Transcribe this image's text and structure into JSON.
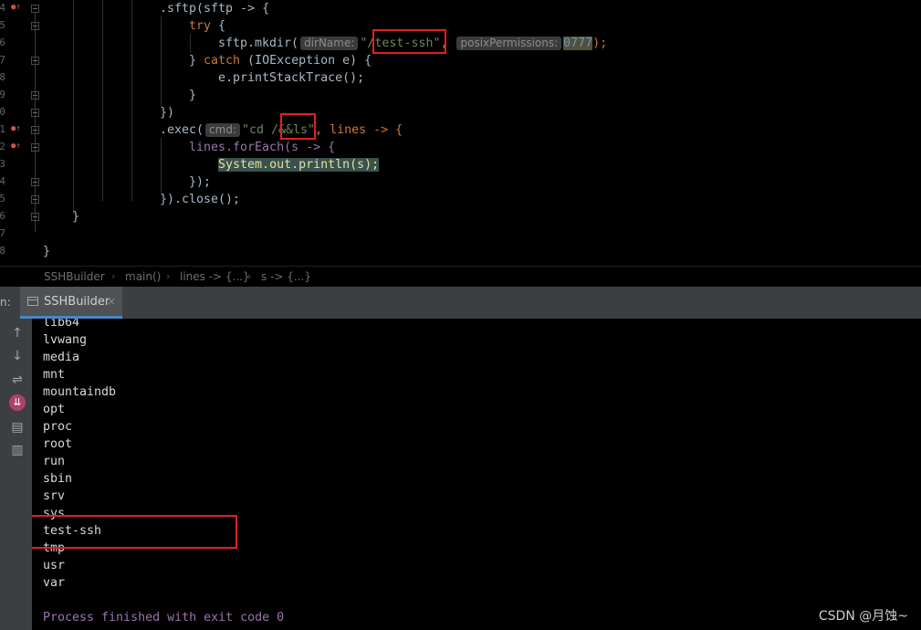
{
  "colors": {
    "keyword": "#cc7832",
    "string": "#6a8759",
    "number": "#6897bb",
    "field": "#9876aa",
    "annotation_box": "#e02020",
    "tab_accent": "#4a88c7"
  },
  "editor": {
    "line_numbers": [
      "4",
      "5",
      "6",
      "7",
      "8",
      "9",
      "0",
      "1",
      "2",
      "3",
      "4",
      "5",
      "6",
      "7",
      "8"
    ],
    "code": {
      "l1": ".sftp(sftp -> {",
      "l2_kw": "try",
      "l2_rest": " {",
      "l3_a": "sftp.mkdir(",
      "l3_hint": "dirName:",
      "l3_str": "\"/test-ssh\"",
      "l3_sep": ",",
      "l3_hint2": "posixPermissions:",
      "l3_num": "0777",
      "l3_end": ");",
      "l4_a": "} ",
      "l4_kw": "catch",
      "l4_b": " (IOException e) {",
      "l5": "e.printStackTrace();",
      "l6": "}",
      "l7": "})",
      "l8_a": ".exec(",
      "l8_hint": "cmd:",
      "l8_str": "\"cd /&&ls\"",
      "l8_b": ", lines -> {",
      "l9": "lines.forEach(s -> {",
      "l10_cls": "System",
      "l10_dot": ".",
      "l10_fld": "out",
      "l10_rest": ".println(s);",
      "l11": "});",
      "l12": "}).close();",
      "l13": "}",
      "l15": "}"
    }
  },
  "breadcrumb": {
    "items": [
      "SSHBuilder",
      "main()",
      "lines -> {...}",
      "s -> {...}"
    ],
    "separator": "›"
  },
  "run_panel": {
    "label": "n:",
    "tab_label": "SSHBuilder",
    "tab_close": "×",
    "icons": [
      "arrow-up-icon",
      "arrow-down-icon",
      "soft-wrap-icon",
      "scroll-to-end-icon",
      "print-icon",
      "trash-icon"
    ]
  },
  "console": {
    "lines": [
      "lib64",
      "lvwang",
      "media",
      "mnt",
      "mountaindb",
      "opt",
      "proc",
      "root",
      "run",
      "sbin",
      "srv",
      "sys",
      "test-ssh",
      "tmp",
      "usr",
      "var",
      ""
    ],
    "process_message": "Process finished with exit code 0"
  },
  "watermark": "CSDN @月蚀~"
}
